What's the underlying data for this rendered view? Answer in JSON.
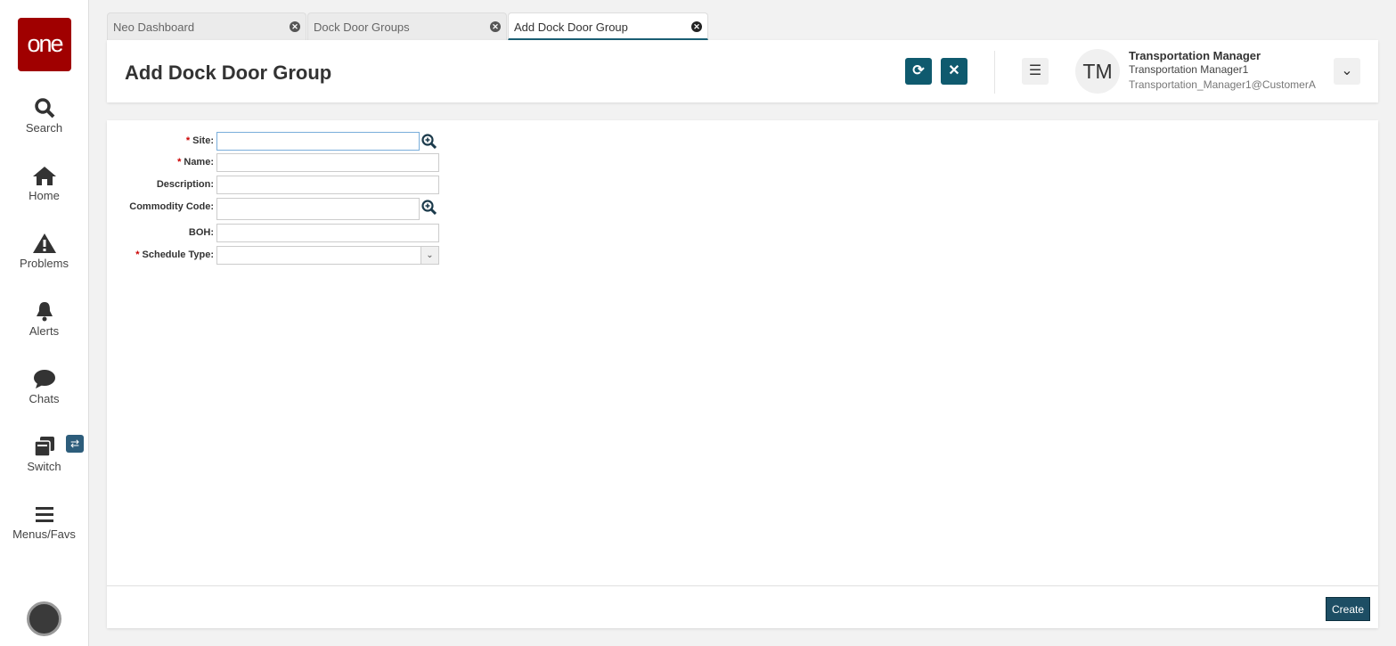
{
  "sidebar": {
    "logo": "one",
    "items": [
      {
        "label": "Search"
      },
      {
        "label": "Home"
      },
      {
        "label": "Problems"
      },
      {
        "label": "Alerts"
      },
      {
        "label": "Chats"
      },
      {
        "label": "Switch"
      },
      {
        "label": "Menus/Favs"
      }
    ],
    "switch_badge": "⇄"
  },
  "tabs": [
    {
      "label": "Neo Dashboard"
    },
    {
      "label": "Dock Door Groups"
    },
    {
      "label": "Add Dock Door Group",
      "active": true
    }
  ],
  "header": {
    "title": "Add Dock Door Group",
    "user_initials": "TM",
    "user_role": "Transportation Manager",
    "user_name": "Transportation Manager1",
    "user_org": "Transportation_Manager1@CustomerA"
  },
  "form": {
    "fields": [
      {
        "label": "Site:",
        "required": true,
        "value": "",
        "lookup": true
      },
      {
        "label": "Name:",
        "required": true,
        "value": ""
      },
      {
        "label": "Description:",
        "required": false,
        "value": ""
      },
      {
        "label": "Commodity Code:",
        "required": false,
        "value": "",
        "lookup": true
      },
      {
        "label": "BOH:",
        "required": false,
        "value": ""
      },
      {
        "label": "Schedule Type:",
        "required": true,
        "value": "",
        "type": "select"
      }
    ]
  },
  "footer": {
    "create_label": "Create"
  },
  "colors": {
    "brand": "#a00000",
    "accent": "#0f5a6e",
    "required": "#cc0000"
  }
}
